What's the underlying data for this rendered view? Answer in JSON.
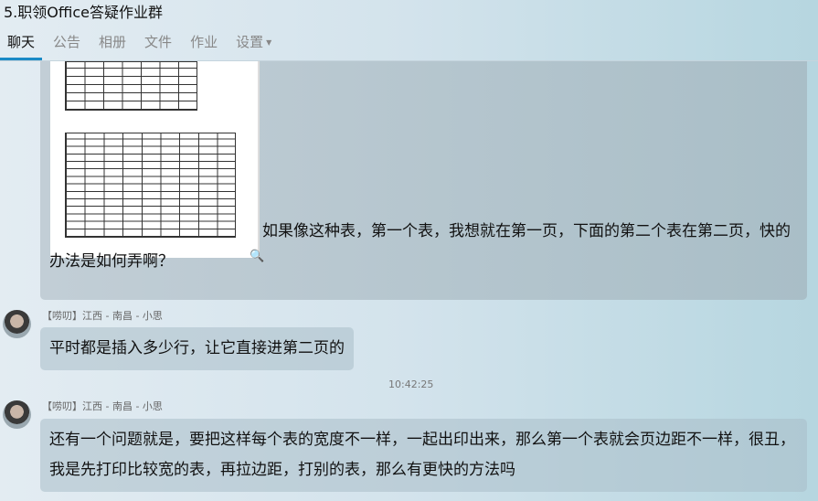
{
  "window": {
    "title": "5.职领Office答疑作业群"
  },
  "tabs": [
    {
      "label": "聊天"
    },
    {
      "label": "公告"
    },
    {
      "label": "相册"
    },
    {
      "label": "文件"
    },
    {
      "label": "作业"
    },
    {
      "label": "设置"
    }
  ],
  "messages": [
    {
      "text": "如果像这种表，第一个表，我想就在第一页，下面的第二个表在第二页，快的办法是如何弄啊？"
    },
    {
      "sender": "【唠叨】江西 - 南昌 - 小思",
      "text": "平时都是插入多少行，让它直接进第二页的"
    },
    {
      "time": "10:42:25"
    },
    {
      "sender": "【唠叨】江西 - 南昌 - 小思",
      "text": "还有一个问题就是，要把这样每个表的宽度不一样，一起出印出来，那么第一个表就会页边距不一样，很丑，我是先打印比较宽的表，再拉边距，打别的表，那么有更快的方法吗"
    }
  ]
}
